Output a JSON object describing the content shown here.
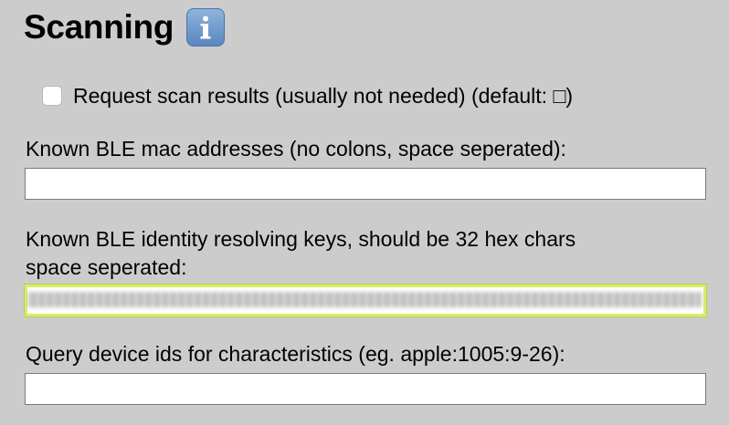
{
  "section": {
    "title": "Scanning",
    "info_icon": "info-icon"
  },
  "checkbox": {
    "label": "Request scan results (usually not needed) (default: □)",
    "checked": false
  },
  "fields": {
    "mac": {
      "label": "Known BLE mac addresses (no colons, space seperated):",
      "value": ""
    },
    "irk": {
      "label_line1": "Known BLE identity resolving keys, should be 32 hex chars",
      "label_line2": "space seperated:",
      "value": ""
    },
    "query": {
      "label": "Query device ids for characteristics (eg. apple:1005:9-26):",
      "value": ""
    }
  },
  "colors": {
    "background": "#cccccc",
    "focus_ring": "#d7ee6a",
    "info_icon": "#6b93c6"
  }
}
